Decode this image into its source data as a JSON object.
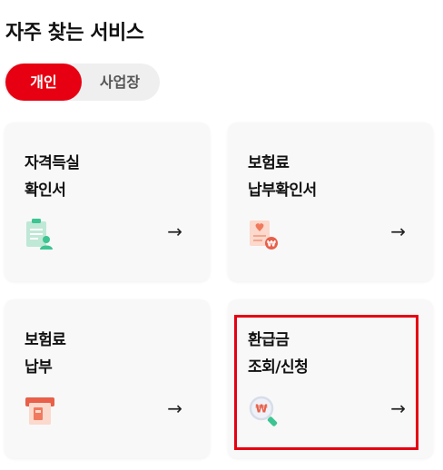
{
  "section": {
    "title": "자주 찾는 서비스"
  },
  "tabs": [
    {
      "label": "개인",
      "active": true
    },
    {
      "label": "사업장",
      "active": false
    }
  ],
  "cards": [
    {
      "line1": "자격득실",
      "line2": "확인서",
      "icon": "certificate-document-icon",
      "arrow": "→"
    },
    {
      "line1": "보험료",
      "line2": "납부확인서",
      "icon": "payment-receipt-icon",
      "arrow": "→"
    },
    {
      "line1": "보험료",
      "line2": "납부",
      "icon": "card-payment-icon",
      "arrow": "→"
    },
    {
      "line1": "환급금",
      "line2": "조회/신청",
      "icon": "refund-search-icon",
      "arrow": "→"
    }
  ],
  "colors": {
    "accent": "#e60012",
    "card_bg": "#f8f8f8",
    "toggle_bg": "#efefef",
    "icon_green": "#3cc492",
    "icon_coral": "#f07a5e"
  }
}
